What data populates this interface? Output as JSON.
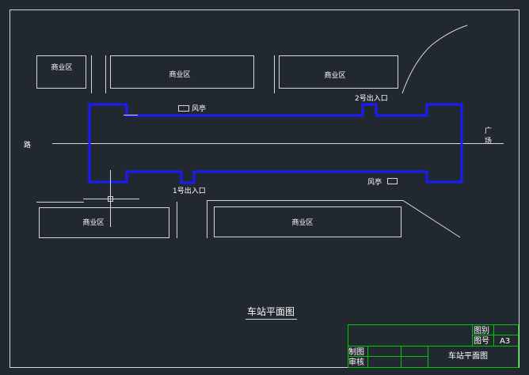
{
  "drawing": {
    "title": "车站平面图",
    "road_label": "路",
    "plaza_label_1": "广",
    "plaza_label_2": "场",
    "exit_1": "1号出入口",
    "exit_2": "2号出入口",
    "kiosk_top": "风亭",
    "kiosk_bottom": "风亭",
    "commercial": {
      "top_left": "商业区",
      "top_mid": "商业区",
      "top_right": "商业区",
      "bottom_left": "商业区",
      "bottom_right": "商业区"
    }
  },
  "title_block": {
    "drawing_type_label": "图别",
    "drawing_no_label": "图号",
    "drawing_no_value": "A3",
    "drawn_label": "制图",
    "checked_label": "审核",
    "name": "车站平面图"
  },
  "colors": {
    "background": "#212830",
    "lines": "#d8d8d8",
    "station_outline": "#1a1aff",
    "title_block": "#00c800"
  }
}
